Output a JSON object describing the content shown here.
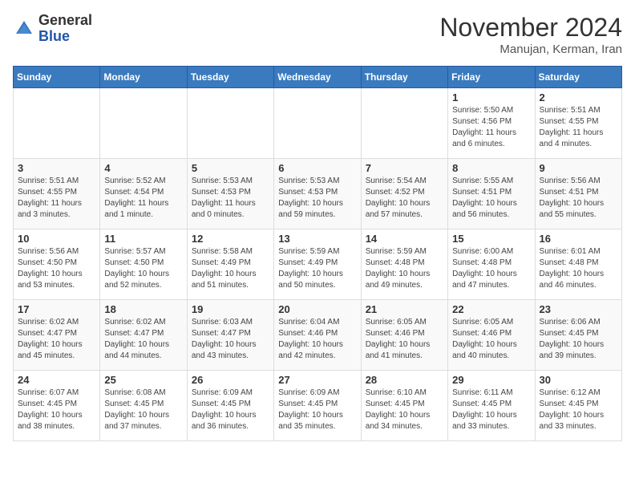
{
  "header": {
    "logo_general": "General",
    "logo_blue": "Blue",
    "month_title": "November 2024",
    "location": "Manujan, Kerman, Iran"
  },
  "weekdays": [
    "Sunday",
    "Monday",
    "Tuesday",
    "Wednesday",
    "Thursday",
    "Friday",
    "Saturday"
  ],
  "weeks": [
    [
      {
        "day": "",
        "info": ""
      },
      {
        "day": "",
        "info": ""
      },
      {
        "day": "",
        "info": ""
      },
      {
        "day": "",
        "info": ""
      },
      {
        "day": "",
        "info": ""
      },
      {
        "day": "1",
        "info": "Sunrise: 5:50 AM\nSunset: 4:56 PM\nDaylight: 11 hours\nand 6 minutes."
      },
      {
        "day": "2",
        "info": "Sunrise: 5:51 AM\nSunset: 4:55 PM\nDaylight: 11 hours\nand 4 minutes."
      }
    ],
    [
      {
        "day": "3",
        "info": "Sunrise: 5:51 AM\nSunset: 4:55 PM\nDaylight: 11 hours\nand 3 minutes."
      },
      {
        "day": "4",
        "info": "Sunrise: 5:52 AM\nSunset: 4:54 PM\nDaylight: 11 hours\nand 1 minute."
      },
      {
        "day": "5",
        "info": "Sunrise: 5:53 AM\nSunset: 4:53 PM\nDaylight: 11 hours\nand 0 minutes."
      },
      {
        "day": "6",
        "info": "Sunrise: 5:53 AM\nSunset: 4:53 PM\nDaylight: 10 hours\nand 59 minutes."
      },
      {
        "day": "7",
        "info": "Sunrise: 5:54 AM\nSunset: 4:52 PM\nDaylight: 10 hours\nand 57 minutes."
      },
      {
        "day": "8",
        "info": "Sunrise: 5:55 AM\nSunset: 4:51 PM\nDaylight: 10 hours\nand 56 minutes."
      },
      {
        "day": "9",
        "info": "Sunrise: 5:56 AM\nSunset: 4:51 PM\nDaylight: 10 hours\nand 55 minutes."
      }
    ],
    [
      {
        "day": "10",
        "info": "Sunrise: 5:56 AM\nSunset: 4:50 PM\nDaylight: 10 hours\nand 53 minutes."
      },
      {
        "day": "11",
        "info": "Sunrise: 5:57 AM\nSunset: 4:50 PM\nDaylight: 10 hours\nand 52 minutes."
      },
      {
        "day": "12",
        "info": "Sunrise: 5:58 AM\nSunset: 4:49 PM\nDaylight: 10 hours\nand 51 minutes."
      },
      {
        "day": "13",
        "info": "Sunrise: 5:59 AM\nSunset: 4:49 PM\nDaylight: 10 hours\nand 50 minutes."
      },
      {
        "day": "14",
        "info": "Sunrise: 5:59 AM\nSunset: 4:48 PM\nDaylight: 10 hours\nand 49 minutes."
      },
      {
        "day": "15",
        "info": "Sunrise: 6:00 AM\nSunset: 4:48 PM\nDaylight: 10 hours\nand 47 minutes."
      },
      {
        "day": "16",
        "info": "Sunrise: 6:01 AM\nSunset: 4:48 PM\nDaylight: 10 hours\nand 46 minutes."
      }
    ],
    [
      {
        "day": "17",
        "info": "Sunrise: 6:02 AM\nSunset: 4:47 PM\nDaylight: 10 hours\nand 45 minutes."
      },
      {
        "day": "18",
        "info": "Sunrise: 6:02 AM\nSunset: 4:47 PM\nDaylight: 10 hours\nand 44 minutes."
      },
      {
        "day": "19",
        "info": "Sunrise: 6:03 AM\nSunset: 4:47 PM\nDaylight: 10 hours\nand 43 minutes."
      },
      {
        "day": "20",
        "info": "Sunrise: 6:04 AM\nSunset: 4:46 PM\nDaylight: 10 hours\nand 42 minutes."
      },
      {
        "day": "21",
        "info": "Sunrise: 6:05 AM\nSunset: 4:46 PM\nDaylight: 10 hours\nand 41 minutes."
      },
      {
        "day": "22",
        "info": "Sunrise: 6:05 AM\nSunset: 4:46 PM\nDaylight: 10 hours\nand 40 minutes."
      },
      {
        "day": "23",
        "info": "Sunrise: 6:06 AM\nSunset: 4:45 PM\nDaylight: 10 hours\nand 39 minutes."
      }
    ],
    [
      {
        "day": "24",
        "info": "Sunrise: 6:07 AM\nSunset: 4:45 PM\nDaylight: 10 hours\nand 38 minutes."
      },
      {
        "day": "25",
        "info": "Sunrise: 6:08 AM\nSunset: 4:45 PM\nDaylight: 10 hours\nand 37 minutes."
      },
      {
        "day": "26",
        "info": "Sunrise: 6:09 AM\nSunset: 4:45 PM\nDaylight: 10 hours\nand 36 minutes."
      },
      {
        "day": "27",
        "info": "Sunrise: 6:09 AM\nSunset: 4:45 PM\nDaylight: 10 hours\nand 35 minutes."
      },
      {
        "day": "28",
        "info": "Sunrise: 6:10 AM\nSunset: 4:45 PM\nDaylight: 10 hours\nand 34 minutes."
      },
      {
        "day": "29",
        "info": "Sunrise: 6:11 AM\nSunset: 4:45 PM\nDaylight: 10 hours\nand 33 minutes."
      },
      {
        "day": "30",
        "info": "Sunrise: 6:12 AM\nSunset: 4:45 PM\nDaylight: 10 hours\nand 33 minutes."
      }
    ]
  ]
}
